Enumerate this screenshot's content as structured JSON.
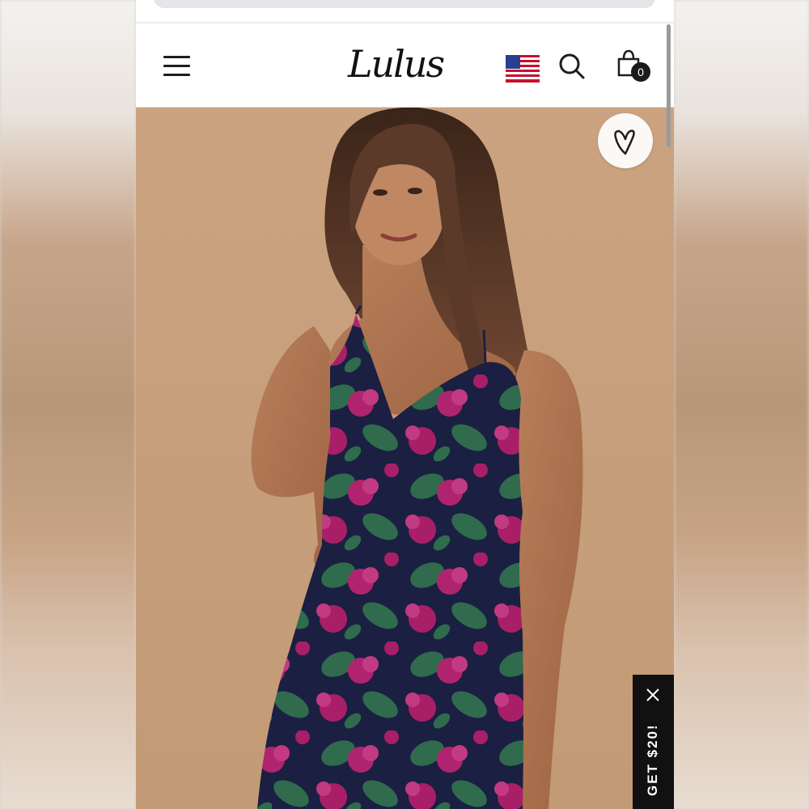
{
  "header": {
    "logo_text": "Lulus",
    "cart_count": "0"
  },
  "icons": {
    "menu": "hamburger-menu-icon",
    "flag": "us-flag-icon",
    "search": "search-icon",
    "cart": "shopping-bag-icon",
    "wishlist": "heart-icon",
    "close": "close-icon"
  },
  "product": {
    "image": "model-in-navy-floral-jacquard-slip-dress",
    "dress_colors": [
      "#1b1f42",
      "#b0246f",
      "#2f6b4c"
    ]
  },
  "promo": {
    "label": "GET $20!"
  },
  "colors": {
    "background": "#c9a27f",
    "header_bg": "#ffffff",
    "promo_bg": "#111111"
  }
}
